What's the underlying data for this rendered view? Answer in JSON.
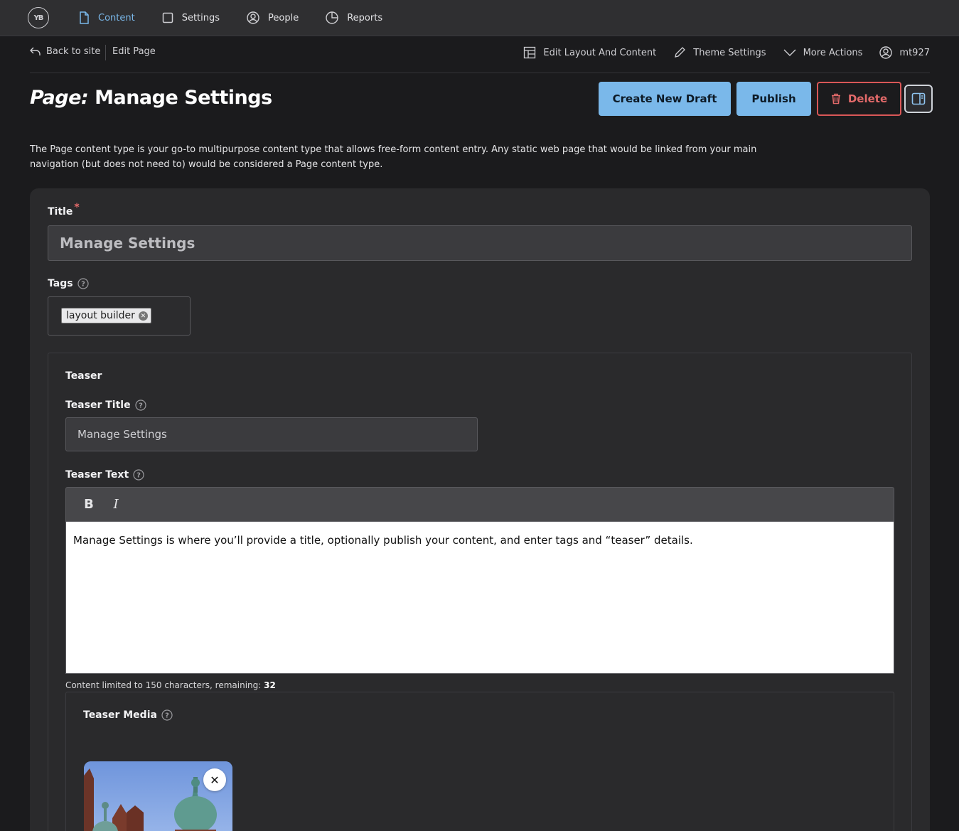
{
  "nav": {
    "logo_text": "YB",
    "items": [
      {
        "label": "Content",
        "icon": "file-icon",
        "active": true
      },
      {
        "label": "Settings",
        "icon": "square-icon",
        "active": false
      },
      {
        "label": "People",
        "icon": "user-circle-icon",
        "active": false
      },
      {
        "label": "Reports",
        "icon": "pie-chart-icon",
        "active": false
      }
    ]
  },
  "subbar": {
    "back_label": "Back to site",
    "breadcrumb": "Edit Page",
    "actions": {
      "edit_layout": "Edit Layout And Content",
      "theme_settings": "Theme Settings",
      "more_actions": "More Actions",
      "user": "mt927"
    }
  },
  "header": {
    "type_label": "Page:",
    "title": "Manage Settings",
    "create_draft": "Create New Draft",
    "publish": "Publish",
    "delete": "Delete"
  },
  "description": "The Page content type is your go-to multipurpose content type that allows free-form content entry. Any static web page that would be linked from your main navigation (but does not need to) would be considered a Page content type.",
  "form": {
    "title_label": "Title",
    "title_required": "*",
    "title_value": "Manage Settings",
    "tags_label": "Tags",
    "tags": [
      "layout builder"
    ],
    "teaser": {
      "section_label": "Teaser",
      "title_label": "Teaser Title",
      "title_value": "Manage Settings",
      "text_label": "Teaser Text",
      "bold_label": "B",
      "italic_label": "I",
      "text_value": "Manage Settings is where you’ll provide a title, optionally publish your content, and enter tags and “teaser” details.",
      "limit_text": "Content limited to 150 characters, remaining: ",
      "remaining": "32",
      "media_label": "Teaser Media"
    }
  },
  "colors": {
    "accent": "#7ab8ea",
    "danger": "#d95757",
    "background": "#1b1b1d",
    "card": "#2a2a2c"
  }
}
